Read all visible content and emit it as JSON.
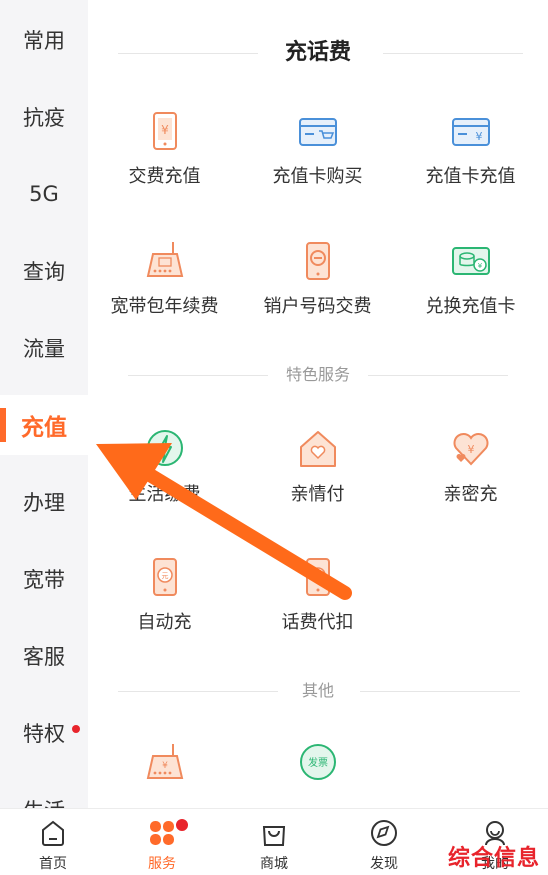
{
  "sidebar": {
    "items": [
      {
        "label": "常用"
      },
      {
        "label": "抗疫"
      },
      {
        "label": "5G"
      },
      {
        "label": "查询"
      },
      {
        "label": "流量"
      },
      {
        "label": "充值",
        "active": true
      },
      {
        "label": "办理"
      },
      {
        "label": "宽带"
      },
      {
        "label": "客服"
      },
      {
        "label": "特权",
        "badge": true
      },
      {
        "label": "生活"
      }
    ]
  },
  "main": {
    "section_recharge": {
      "title": "充话费",
      "items": [
        {
          "label": "交费充值",
          "icon": "phone-yen-icon"
        },
        {
          "label": "充值卡购买",
          "icon": "card-cart-icon"
        },
        {
          "label": "充值卡充值",
          "icon": "card-yen-icon"
        },
        {
          "label": "宽带包年续费",
          "icon": "router-icon"
        },
        {
          "label": "销户号码交费",
          "icon": "phone-minus-icon"
        },
        {
          "label": "兑换充值卡",
          "icon": "card-exchange-icon"
        }
      ]
    },
    "section_special": {
      "title": "特色服务",
      "items": [
        {
          "label": "生活缴费",
          "icon": "lightning-icon"
        },
        {
          "label": "亲情付",
          "icon": "house-heart-icon"
        },
        {
          "label": "亲密充",
          "icon": "hearts-icon"
        },
        {
          "label": "自动充",
          "icon": "phone-auto-icon"
        },
        {
          "label": "话费代扣",
          "icon": "phone-deduct-icon"
        }
      ]
    },
    "section_other": {
      "title": "其他",
      "items": [
        {
          "label": "",
          "icon": "router-yen-icon"
        },
        {
          "label": "",
          "icon": "invoice-badge-icon",
          "badge_text": "发票"
        }
      ]
    }
  },
  "tabbar": {
    "tabs": [
      {
        "label": "首页",
        "icon": "home-icon"
      },
      {
        "label": "服务",
        "icon": "service-clover-icon",
        "active": true,
        "badge": true
      },
      {
        "label": "商城",
        "icon": "shopping-bag-icon"
      },
      {
        "label": "发现",
        "icon": "compass-icon"
      },
      {
        "label": "我的",
        "icon": "user-icon"
      }
    ]
  },
  "watermark": "综合信息",
  "colors": {
    "accent": "#ff6a2a",
    "badge": "#e8242c",
    "icon_orange": "#f08a5d",
    "icon_blue": "#4a90d9",
    "icon_green": "#2bb673"
  }
}
